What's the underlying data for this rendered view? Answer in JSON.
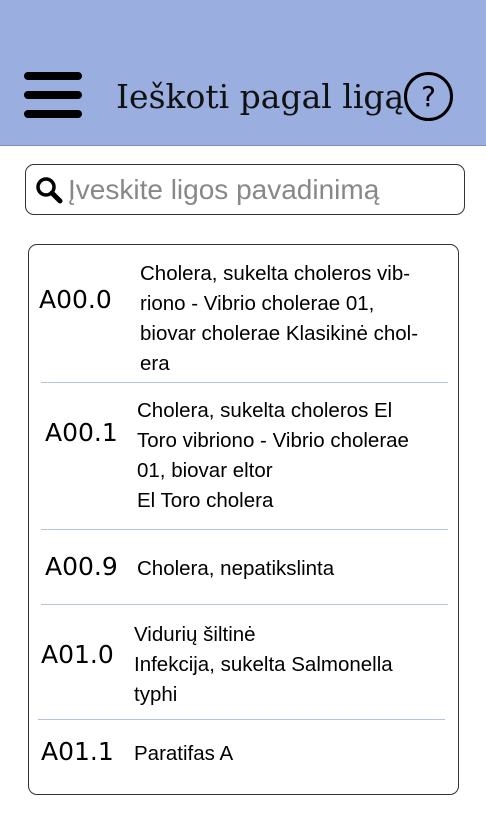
{
  "header": {
    "title": "Ieškoti pagal ligą",
    "menu_icon": "hamburger-menu-icon",
    "help_label": "?",
    "background_color": "#9aaee0"
  },
  "search": {
    "placeholder": "Įveskite ligos pavadinimą",
    "value": "",
    "icon": "search-icon"
  },
  "results": [
    {
      "code": "A00.0",
      "description": "Cholera, sukelta choleros vib-\nriono - Vibrio cholerae 01,\nbiovar cholerae Klasikinė chol-\nera"
    },
    {
      "code": "A00.1",
      "description": "Cholera, sukelta choleros El\nToro vibriono - Vibrio cholerae\n01, biovar eltor\nEl Toro cholera"
    },
    {
      "code": "A00.9",
      "description": "Cholera, nepatikslinta"
    },
    {
      "code": "A01.0",
      "description": "Vidurių šiltinė\nInfekcija, sukelta Salmonella\ntyphi"
    },
    {
      "code": "A01.1",
      "description": "Paratifas A"
    }
  ]
}
